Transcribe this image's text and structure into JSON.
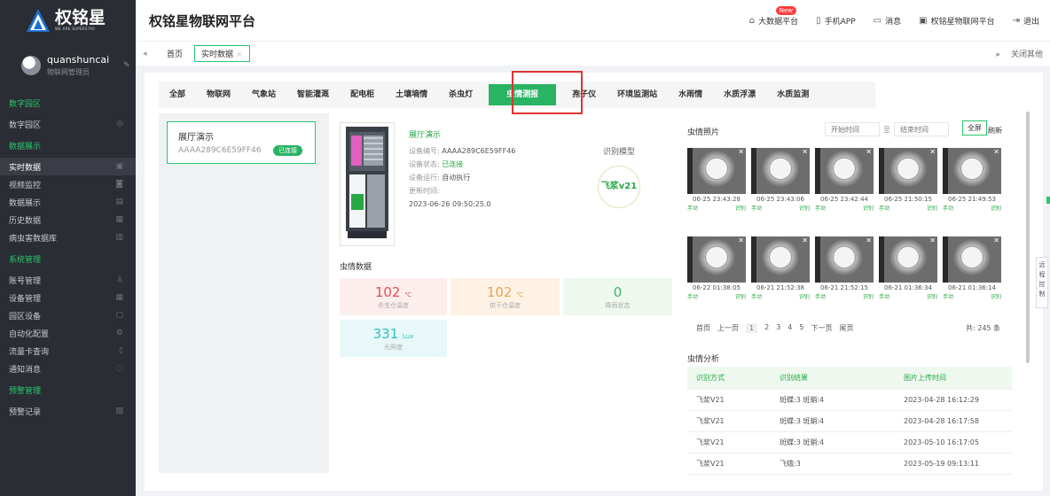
{
  "brand": {
    "name": "权铭星",
    "tagline": "WE ARE SUPERSTAR"
  },
  "user": {
    "name": "quanshuncai",
    "role": "物联网管理员"
  },
  "sidebar": [
    {
      "type": "section",
      "label": "数字园区"
    },
    {
      "type": "item",
      "label": "数字园区",
      "icon": "compass-icon"
    },
    {
      "type": "section",
      "label": "数据展示"
    },
    {
      "type": "item",
      "label": "实时数据",
      "icon": "image-icon",
      "active": true
    },
    {
      "type": "item",
      "label": "视频监控",
      "icon": "camera-icon"
    },
    {
      "type": "item",
      "label": "数据展示",
      "icon": "doc-icon"
    },
    {
      "type": "item",
      "label": "历史数据",
      "icon": "chart-icon"
    },
    {
      "type": "item",
      "label": "病虫害数据库",
      "icon": "book-icon"
    },
    {
      "type": "section",
      "label": "系统管理"
    },
    {
      "type": "item",
      "label": "账号管理",
      "icon": "user-icon"
    },
    {
      "type": "item",
      "label": "设备管理",
      "icon": "grid-icon"
    },
    {
      "type": "item",
      "label": "园区设备",
      "icon": "box-icon"
    },
    {
      "type": "item",
      "label": "自动化配置",
      "icon": "gear-icon"
    },
    {
      "type": "item",
      "label": "流量卡查询",
      "icon": "sim-icon"
    },
    {
      "type": "item",
      "label": "通知消息",
      "icon": "bell-icon"
    },
    {
      "type": "section",
      "label": "预警管理"
    },
    {
      "type": "item",
      "label": "预警记录",
      "icon": "alert-icon"
    }
  ],
  "header": {
    "title": "权铭星物联网平台",
    "bigdata": "大数据平台",
    "new_badge": "New",
    "app": "手机APP",
    "msg": "消息",
    "platform": "权铭星物联网平台",
    "logout": "退出"
  },
  "tabs": {
    "home": "首页",
    "current": "实时数据",
    "close_others": "关闭其他"
  },
  "categories": [
    "全部",
    "物联网",
    "气象站",
    "智能灌溉",
    "配电柜",
    "土壤墒情",
    "杀虫灯",
    "虫情测报",
    "孢子仪",
    "环境监测站",
    "水雨情",
    "水质浮漂",
    "水质监测"
  ],
  "active_category": "虫情测报",
  "device_card": {
    "name": "展厅演示",
    "code": "AAAA289C6E59FF46",
    "status": "已连接"
  },
  "device_info": {
    "title": "展厅演示",
    "code_label": "设备编号:",
    "code": "AAAA289C6E59FF46",
    "status_label": "设备状态:",
    "status": "已连接",
    "run_label": "设备运行:",
    "run": "自动执行",
    "update_label": "更新时间:",
    "time": "2023-06-26 09:50:25.0"
  },
  "model": {
    "label": "识别模型",
    "name": "飞浆v21"
  },
  "sensor": {
    "label": "虫情数据",
    "kill_temp": {
      "value": "102",
      "unit": "℃",
      "label": "杀虫仓温度"
    },
    "dry_temp": {
      "value": "102",
      "unit": "℃",
      "label": "烘干仓温度"
    },
    "rain": {
      "value": "0",
      "label": "降雨状态"
    },
    "light": {
      "value": "331",
      "unit": "Lux",
      "label": "光照度"
    }
  },
  "photos": {
    "label": "虫情照片",
    "start_placeholder": "开始时间",
    "to": "至",
    "end_placeholder": "结束时间",
    "full": "全屏",
    "refresh": "刷新",
    "items": [
      {
        "date": "06-25 23:43:28",
        "mode": "手动",
        "tag": "识别"
      },
      {
        "date": "06-25 23:43:06",
        "mode": "手动",
        "tag": "识别"
      },
      {
        "date": "06-25 23:42:44",
        "mode": "手动",
        "tag": "识别"
      },
      {
        "date": "06-25 21:50:15",
        "mode": "手动",
        "tag": "识别"
      },
      {
        "date": "06-25 21:49:53",
        "mode": "手动",
        "tag": "识别"
      },
      {
        "date": "06-22 01:38:05",
        "mode": "手动",
        "tag": "识别"
      },
      {
        "date": "06-21 21:52:38",
        "mode": "手动",
        "tag": "识别"
      },
      {
        "date": "06-21 21:52:15",
        "mode": "手动",
        "tag": "识别"
      },
      {
        "date": "06-21 01:36:34",
        "mode": "手动",
        "tag": "识别"
      },
      {
        "date": "06-21 01:36:14",
        "mode": "手动",
        "tag": "识别"
      }
    ],
    "pager": {
      "first": "首页",
      "prev": "上一页",
      "pages": [
        "1",
        "2",
        "3",
        "4",
        "5"
      ],
      "current": "1",
      "next": "下一页",
      "last": "尾页",
      "total": "共: 245 条"
    }
  },
  "analysis": {
    "label": "虫情分析",
    "headers": [
      "识别方式",
      "识别结果",
      "图片上传时间"
    ],
    "rows": [
      [
        "飞浆V21",
        "斑蝶:3 斑蛸:4",
        "2023-04-28 16:12:29"
      ],
      [
        "飞浆V21",
        "斑蝶:3 斑蛸:4",
        "2023-04-28 16:17:58"
      ],
      [
        "飞浆V21",
        "斑蝶:3 斑蛸:4",
        "2023-05-10 16:17:05"
      ],
      [
        "飞浆V21",
        "飞蛾:3",
        "2023-05-19 09:13:11"
      ]
    ]
  },
  "remote_control": "远程控制",
  "colors": {
    "accent": "#28b463",
    "sidebar_bg": "#2b2d34",
    "section": "#28c76f",
    "highlight": "#e03333"
  }
}
